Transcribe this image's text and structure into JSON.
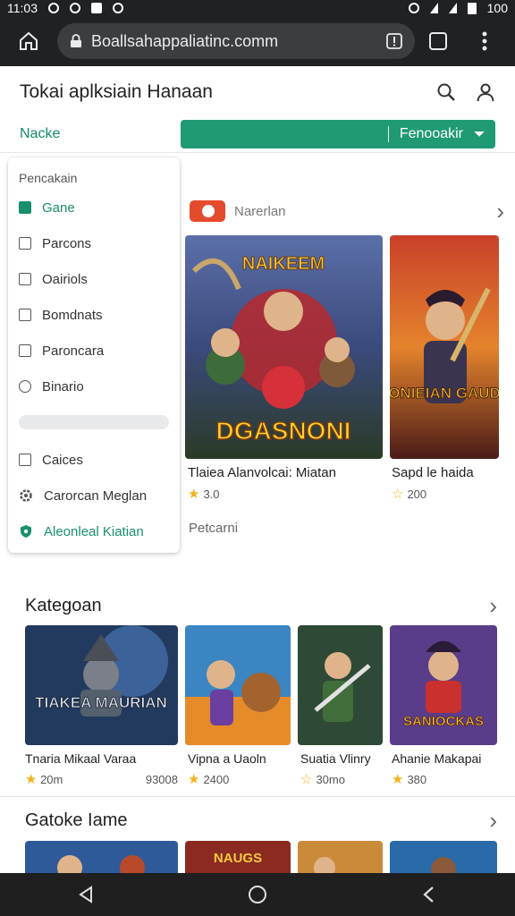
{
  "status_bar": {
    "time": "11:03",
    "battery": "100"
  },
  "browser": {
    "url": "Boallsahappaliatinc.comm"
  },
  "header": {
    "title": "Tokai aplksiain Hanaan"
  },
  "subrow": {
    "left_label": "Nacke",
    "button_label": "Fenooakir"
  },
  "dropdown": {
    "heading": "Pencakain",
    "items": [
      {
        "label": "Gane",
        "icon": "checkbox-checked-icon",
        "active": true
      },
      {
        "label": "Parcons",
        "icon": "document-icon",
        "active": false
      },
      {
        "label": "Oairiols",
        "icon": "folder-icon",
        "active": false
      },
      {
        "label": "Bomdnats",
        "icon": "square-icon",
        "active": false
      },
      {
        "label": "Paroncara",
        "icon": "square-icon",
        "active": false
      },
      {
        "label": "Binario",
        "icon": "circle-icon",
        "active": false
      },
      {
        "label": "Caices",
        "icon": "checkbox-icon",
        "active": false
      },
      {
        "label": "Carorcan Meglan",
        "icon": "gear-icon",
        "active": false
      },
      {
        "label": "Aleonleal Kiatian",
        "icon": "shield-icon",
        "active": true
      }
    ]
  },
  "featured": {
    "label": "Narerlan",
    "items": [
      {
        "title": "Tlaiea Alanvolcai: Miatan",
        "rating": "3.0",
        "art_text": "DGASNONI",
        "art_top": "NAIKEEM"
      },
      {
        "title": "Sapd le haida",
        "rating": "200",
        "art_text": "SONIEIAN GAUDE",
        "art_top": ""
      }
    ],
    "more_label": "Petcarni"
  },
  "categories": {
    "title": "Kategoan",
    "items": [
      {
        "title": "Tnaria Mikaal Varaa",
        "rating": "20m",
        "extra": "93008",
        "art_text": "TIAKEA MAURIAN"
      },
      {
        "title": "Vipna a Uaoln",
        "rating": "2400",
        "extra": "",
        "art_text": ""
      },
      {
        "title": "Suatia Vlinry",
        "rating": "30mo",
        "extra": "",
        "art_text": ""
      },
      {
        "title": "Ahanie Makapai",
        "rating": "380",
        "extra": "",
        "art_text": "SANIOCKAS"
      }
    ]
  },
  "games_section": {
    "title": "Gatoke Iame",
    "thumb_text": "NAUGS"
  },
  "colors": {
    "accent": "#1f9a75",
    "dark": "#202124"
  }
}
